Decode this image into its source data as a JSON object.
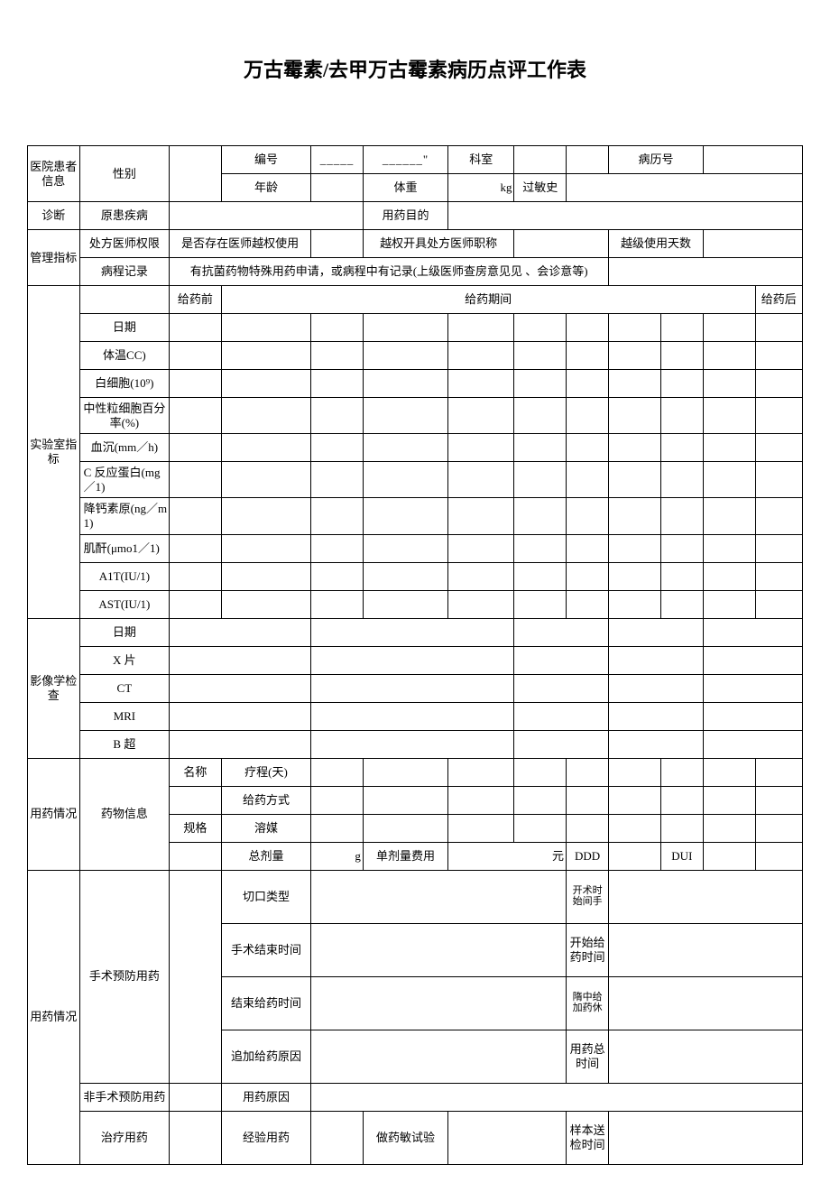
{
  "title": "万古霉素/去甲万古霉素病历点评工作表",
  "sections": {
    "patient": {
      "label": "医院患者信息",
      "number": "编号",
      "number_blank": "_____",
      "number_blank2": "______\"",
      "dept": "科室",
      "record_no": "病历号",
      "sex": "性别",
      "age": "年龄",
      "weight": "体重",
      "weight_unit": "kg",
      "allergy": "过敏史"
    },
    "diagnosis": {
      "label": "诊断",
      "orig": "原患疾病",
      "purpose": "用药目的"
    },
    "manage": {
      "label": "管理指标",
      "rx_auth": "处方医师权限",
      "over_use": "是否存在医师越权使用",
      "over_title": "越权开具处方医师职称",
      "over_days": "越级使用天数",
      "record": "病程记录",
      "record_text": "有抗菌药物特殊用药申请，或病程中有记录(上级医师查房意见见 、会诊意等)"
    },
    "lab": {
      "label": "实验室指标",
      "pre": "给药前",
      "during": "给药期间",
      "post": "给药后",
      "rows": [
        "日期",
        "体温CC)",
        "白细胞(10⁹)",
        "中性粒细胞百分率(%)",
        "血沉(mm／h)",
        "C 反应蛋白(mg／1)",
        "降钙素原(ng／m1)",
        "肌酐(μmo1／1)",
        "A1T(IU/1)",
        "AST(IU/1)"
      ]
    },
    "imaging": {
      "label": "影像学检查",
      "rows": [
        "日期",
        "X 片",
        "CT",
        "MRI",
        "B 超"
      ]
    },
    "med": {
      "label": "用药情况",
      "info": "药物信息",
      "name": "名称",
      "course": "疗程(天)",
      "route": "给药方式",
      "spec": "规格",
      "solvent": "溶媒",
      "total": "总剂量",
      "total_unit": "g",
      "single_cost": "单剂量费用",
      "cost_unit": "元",
      "ddd": "DDD",
      "dui": "DUI"
    },
    "usage": {
      "label": "用药情况",
      "surgery": "手术预防用药",
      "incision": "切口类型",
      "op_start": "开术时始间手",
      "op_end": "手术结束时间",
      "start_med": "开始给药时间",
      "end_med": "结束给药时间",
      "intra": "隋中给加药休",
      "reason": "追加给药原因",
      "total_time": "用药总时间",
      "nonsurgery": "非手术预防用药",
      "med_reason": "用药原因",
      "treat": "治疗用药",
      "empirical": "经验用药",
      "sensitivity": "做药敏试验",
      "sample_time": "样本送检时间"
    }
  }
}
